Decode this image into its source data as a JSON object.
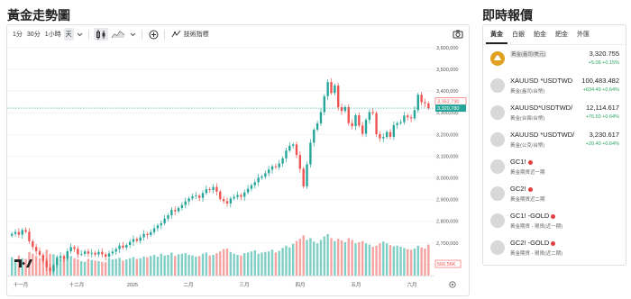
{
  "titles": {
    "chart": "黃金走勢圖",
    "quotes": "即時報價"
  },
  "toolbar": {
    "intervals": [
      "1分",
      "30分",
      "1小時",
      "天"
    ],
    "active_interval": "天",
    "indicators_label": "技術指標"
  },
  "chart_data": {
    "type": "candlestick",
    "price_axis": {
      "ticks": [
        3600000,
        3500000,
        3400000,
        3300000,
        3200000,
        3100000,
        3000000,
        2900000,
        2800000,
        2700000,
        2600000
      ],
      "range": [
        2550000,
        3620000
      ]
    },
    "time_axis": {
      "labels": [
        "十一月",
        "十二月",
        "2025",
        "二月",
        "三月",
        "四月",
        "五月",
        "六月"
      ]
    },
    "price_labels": {
      "crosshair": "3,352,730",
      "last": "3,320,780",
      "volume": "566.56K"
    },
    "colors": {
      "up": "#26a69a",
      "down": "#ef5350",
      "up_volume": "#7fcfc6",
      "down_volume": "#f4a3a1",
      "last_line": "#26a69a"
    },
    "closes": [
      2742000,
      2751000,
      2738000,
      2760000,
      2752000,
      2708000,
      2682000,
      2663000,
      2645000,
      2618000,
      2588000,
      2570000,
      2598000,
      2631000,
      2640000,
      2628000,
      2662000,
      2681000,
      2673000,
      2648000,
      2650000,
      2661000,
      2651000,
      2655000,
      2647000,
      2659000,
      2648000,
      2637000,
      2652000,
      2660000,
      2672000,
      2688000,
      2679000,
      2691000,
      2705000,
      2718000,
      2710000,
      2726000,
      2742000,
      2737000,
      2750000,
      2768000,
      2781000,
      2791000,
      2812000,
      2828000,
      2852000,
      2846000,
      2861000,
      2875000,
      2892000,
      2905000,
      2915000,
      2918000,
      2908000,
      2930000,
      2948000,
      2944000,
      2958000,
      2937000,
      2902000,
      2893000,
      2882000,
      2905000,
      2912000,
      2921000,
      2913000,
      2933000,
      2950000,
      2966000,
      2980000,
      3001000,
      3006000,
      3021000,
      3038000,
      3053000,
      3049000,
      3066000,
      3090000,
      3126000,
      3148000,
      3154000,
      3105000,
      3042000,
      2961000,
      3062000,
      3162000,
      3222000,
      3251000,
      3303000,
      3376000,
      3441000,
      3391000,
      3425000,
      3325000,
      3308000,
      3326000,
      3252000,
      3238000,
      3288000,
      3241000,
      3203000,
      3267000,
      3303000,
      3298000,
      3201000,
      3182000,
      3188000,
      3211000,
      3189000,
      3243000,
      3252000,
      3257000,
      3287000,
      3279000,
      3274000,
      3312000,
      3383000,
      3348000,
      3343000,
      3321000
    ],
    "volumes": [
      320,
      280,
      350,
      300,
      290,
      410,
      380,
      340,
      300,
      360,
      450,
      380,
      370,
      330,
      290,
      310,
      360,
      340,
      300,
      280,
      250,
      240,
      290,
      270,
      260,
      250,
      240,
      230,
      300,
      280,
      290,
      310,
      260,
      280,
      300,
      320,
      290,
      300,
      330,
      320,
      340,
      360,
      330,
      380,
      350,
      360,
      400,
      340,
      370,
      380,
      390,
      360,
      350,
      330,
      340,
      380,
      400,
      350,
      360,
      390,
      420,
      460,
      470,
      410,
      380,
      360,
      350,
      390,
      400,
      420,
      440,
      380,
      400,
      410,
      420,
      450,
      400,
      430,
      480,
      520,
      490,
      550,
      600,
      640,
      700,
      620,
      650,
      590,
      560,
      620,
      680,
      720,
      650,
      600,
      640,
      610,
      580,
      650,
      620,
      560,
      580,
      600,
      560,
      540,
      500,
      520,
      560,
      590,
      560,
      530,
      510,
      520,
      500,
      480,
      460,
      450,
      470,
      520,
      490,
      470,
      540
    ]
  },
  "quotes": {
    "tabs": [
      "黃金",
      "白銀",
      "鉑金",
      "鈀金",
      "外匯"
    ],
    "active_tab": "黃金",
    "items": [
      {
        "symbol": "",
        "sub": "黃金(盎司/美元)",
        "price": "3,320.755",
        "change": "+5.06  +0.15%",
        "icon": "gold-bar-icon"
      },
      {
        "symbol": "XAUUSD *USDTWD",
        "sub": "黃金(盎司/台幣)",
        "price": "100,483.482",
        "change": "+634.49  +0.64%",
        "icon": "symbol-icon"
      },
      {
        "symbol": "XAUUSD*USDTWD/",
        "sub": "黃金(台兩/台幣)",
        "price": "12,114.617",
        "change": "+76.50  +0.64%",
        "icon": "symbol-icon"
      },
      {
        "symbol": "XAUUSD *USDTWD/",
        "sub": "黃金(公克/台幣)",
        "price": "3,230.617",
        "change": "+20.40  +0.64%",
        "icon": "symbol-icon"
      },
      {
        "symbol": "GC1!",
        "sub": "黃金期貨近一期",
        "price": "",
        "change": "",
        "icon": "symbol-icon"
      },
      {
        "symbol": "GC2!",
        "sub": "黃金期貨近二期",
        "price": "",
        "change": "",
        "icon": "symbol-icon"
      },
      {
        "symbol": "GC1! -GOLD",
        "sub": "黃金期貨 - 現貨(近一期)",
        "price": "",
        "change": "",
        "icon": "symbol-icon"
      },
      {
        "symbol": "GC2! -GOLD",
        "sub": "黃金期貨 - 現貨(近二期)",
        "price": "",
        "change": "",
        "icon": "symbol-icon"
      }
    ]
  }
}
